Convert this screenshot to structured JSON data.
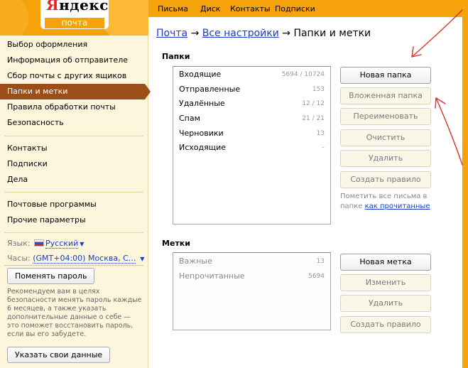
{
  "logo": {
    "brand": "Яндекс",
    "brand_first": "Я",
    "brand_rest": "ндекс",
    "service": "почта"
  },
  "topnav": [
    "Письма",
    "Диск",
    "Контакты",
    "Подписки"
  ],
  "sidebar": {
    "group1": [
      "Выбор оформления",
      "Информация об отправителе",
      "Сбор почты с других ящиков",
      "Папки и метки",
      "Правила обработки почты",
      "Безопасность"
    ],
    "group2": [
      "Контакты",
      "Подписки",
      "Дела"
    ],
    "group3": [
      "Почтовые программы",
      "Прочие параметры"
    ],
    "active_index": 3,
    "language_label": "Язык:",
    "language_value": "Русский",
    "timezone_label": "Часы:",
    "timezone_value": "(GMT+04:00) Москва, С...",
    "change_password_button": "Поменять пароль",
    "password_note": "Рекомендуем вам в целях безопасности менять пароль каждые 6 месяцев, а также указать дополнительные данные о себе — это поможет восстановить пароль, если вы его забудете.",
    "enter_data_button": "Указать свои данные"
  },
  "breadcrumb": {
    "mail": "Почта",
    "arrow1": "→",
    "settings": "Все настройки",
    "arrow2": "→",
    "current": "Папки и метки"
  },
  "folders": {
    "title": "Папки",
    "items": [
      {
        "name": "Входящие",
        "count": "5694 / 10724"
      },
      {
        "name": "Отправленные",
        "count": "153"
      },
      {
        "name": "Удалённые",
        "count": "12 / 12"
      },
      {
        "name": "Спам",
        "count": "21 / 21"
      },
      {
        "name": "Черновики",
        "count": "13"
      },
      {
        "name": "Исходящие",
        "count": "–"
      }
    ],
    "buttons": [
      "Новая папка",
      "Вложенная папка",
      "Переименовать",
      "Очистить",
      "Удалить",
      "Создать правило"
    ],
    "hint_text": "Пометить все письма в папке",
    "hint_link": "как прочитанные"
  },
  "labels": {
    "title": "Метки",
    "items": [
      {
        "name": "Важные",
        "count": "13"
      },
      {
        "name": "Непрочитанные",
        "count": "5694"
      }
    ],
    "buttons": [
      "Новая метка",
      "Изменить",
      "Удалить",
      "Создать правило"
    ]
  },
  "colors": {
    "accent": "#f5a20b",
    "sidebar_bg": "#fdf6dd",
    "active_item": "#9b4e17",
    "link": "#1a3dc1",
    "annotation_arrow": "#d8322a"
  }
}
